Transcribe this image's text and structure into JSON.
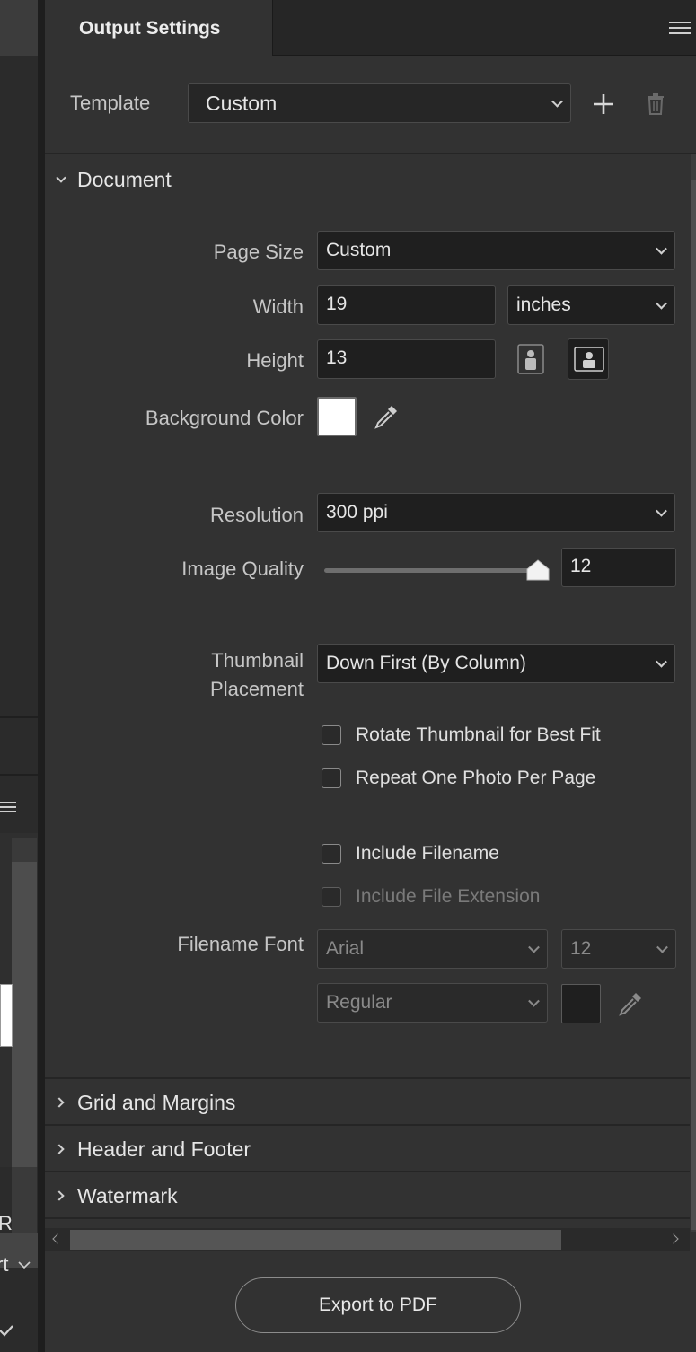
{
  "panel": {
    "tab_title": "Output Settings",
    "menu_icon": "hamburger-menu-icon"
  },
  "template": {
    "label": "Template",
    "value": "Custom",
    "add_icon": "plus-icon",
    "delete_icon": "trash-icon"
  },
  "document": {
    "title": "Document",
    "page_size": {
      "label": "Page Size",
      "value": "Custom"
    },
    "width": {
      "label": "Width",
      "value": "19",
      "unit": "inches"
    },
    "height": {
      "label": "Height",
      "value": "13"
    },
    "background_color": {
      "label": "Background Color",
      "color": "#ffffff"
    },
    "resolution": {
      "label": "Resolution",
      "value": "300 ppi"
    },
    "image_quality": {
      "label": "Image Quality",
      "value": "12",
      "slider_fraction": 1.0
    },
    "thumbnail_placement": {
      "label_line1": "Thumbnail",
      "label_line2": "Placement",
      "value": "Down First (By Column)"
    },
    "rotate_thumbnail": {
      "label": "Rotate Thumbnail for Best Fit",
      "checked": false
    },
    "repeat_photo": {
      "label": "Repeat One Photo Per Page",
      "checked": false
    },
    "include_filename": {
      "label": "Include Filename",
      "checked": false
    },
    "include_extension": {
      "label": "Include File Extension",
      "checked": false,
      "disabled": true
    },
    "filename_font": {
      "label": "Filename Font",
      "family": "Arial",
      "size": "12",
      "style": "Regular",
      "color": "#1f1f1f"
    }
  },
  "sections": [
    {
      "title": "Grid and Margins"
    },
    {
      "title": "Header and Footer"
    },
    {
      "title": "Watermark"
    }
  ],
  "export_button": "Export to PDF",
  "left_strip": {
    "letter_r": "R",
    "letter_rt": "rt"
  }
}
